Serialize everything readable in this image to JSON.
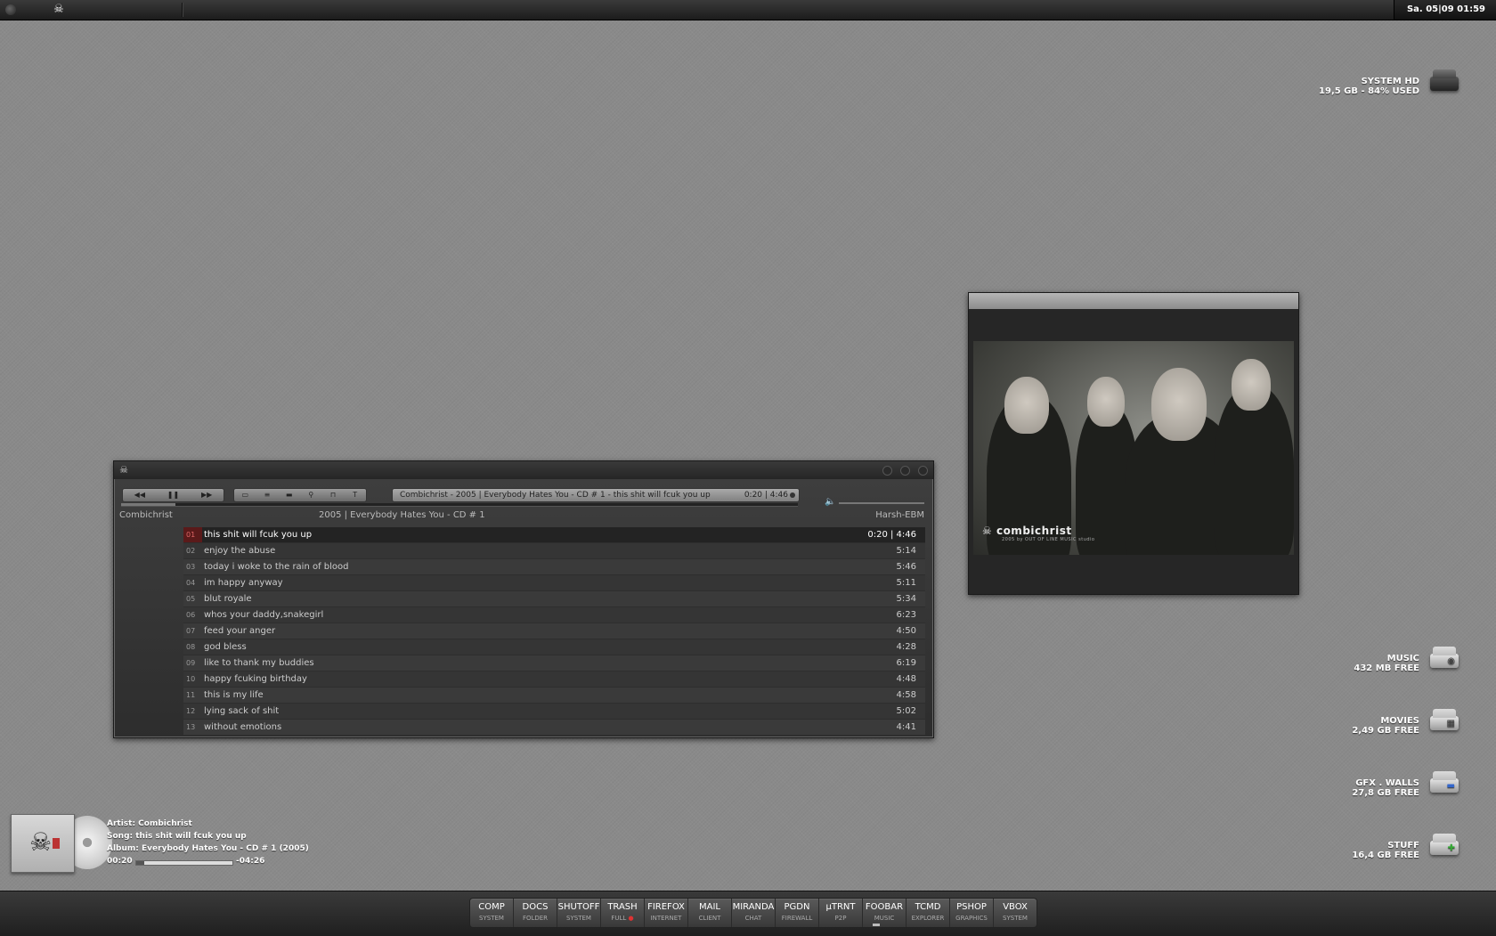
{
  "topbar": {
    "clock": "Sa. 05|09  01:59",
    "app_icon": "skull-icon"
  },
  "drives": [
    {
      "name": "SYSTEM HD",
      "info": "19,5 GB - 84% USED",
      "icon": "hard-disk-icon"
    },
    {
      "name": "MUSIC",
      "info": "432 MB FREE",
      "icon": "music-drive-icon"
    },
    {
      "name": "MOVIES",
      "info": "2,49 GB FREE",
      "icon": "movies-drive-icon"
    },
    {
      "name": "GFX . WALLS",
      "info": "27,8 GB FREE",
      "icon": "gfx-drive-icon"
    },
    {
      "name": "STUFF",
      "info": "16,4 GB FREE",
      "icon": "stuff-drive-icon"
    }
  ],
  "player": {
    "nowplaying": "Combichrist - 2005 | Everybody Hates You - CD # 1 - this shit will fcuk you up",
    "time": "0:20 | 4:46",
    "artist": "Combichrist",
    "album_line": "2005 | Everybody Hates You - CD # 1",
    "genre": "Harsh-EBM",
    "controls": {
      "prev": "◀◀",
      "pause": "❚❚",
      "next": "▶▶"
    },
    "tracks": [
      {
        "num": "01",
        "title": "this shit will fcuk you up",
        "dur": "0:20 | 4:46"
      },
      {
        "num": "02",
        "title": "enjoy the abuse",
        "dur": "5:14"
      },
      {
        "num": "03",
        "title": "today i woke to the rain of blood",
        "dur": "5:46"
      },
      {
        "num": "04",
        "title": "im happy anyway",
        "dur": "5:11"
      },
      {
        "num": "05",
        "title": "blut royale",
        "dur": "5:34"
      },
      {
        "num": "06",
        "title": "whos your daddy,snakegirl",
        "dur": "6:23"
      },
      {
        "num": "07",
        "title": "feed your anger",
        "dur": "4:50"
      },
      {
        "num": "08",
        "title": "god bless",
        "dur": "4:28"
      },
      {
        "num": "09",
        "title": "like to thank my buddies",
        "dur": "6:19"
      },
      {
        "num": "10",
        "title": "happy fcuking birthday",
        "dur": "4:48"
      },
      {
        "num": "11",
        "title": "this is my life",
        "dur": "4:58"
      },
      {
        "num": "12",
        "title": "lying sack of shit",
        "dur": "5:02"
      },
      {
        "num": "13",
        "title": "without emotions",
        "dur": "4:41"
      }
    ]
  },
  "artwork": {
    "logo": "combichrist",
    "logo_sub": "2005 by OUT OF LINE MUSIC studio"
  },
  "widget": {
    "artist": "Artist: Combichrist",
    "song": "Song: this shit will fcuk you up",
    "album": "Album: Everybody Hates You - CD # 1 (2005)",
    "elapsed": "00:20",
    "remaining": "-04:26"
  },
  "dock": [
    {
      "a": "COMP",
      "b": "SYSTEM"
    },
    {
      "a": "DOCS",
      "b": "FOLDER"
    },
    {
      "a": "SHUTOFF",
      "b": "SYSTEM"
    },
    {
      "a": "TRASH",
      "b": "FULL"
    },
    {
      "a": "FIREFOX",
      "b": "INTERNET"
    },
    {
      "a": "MAIL",
      "b": "CLIENT"
    },
    {
      "a": "MIRANDA",
      "b": "CHAT"
    },
    {
      "a": "PGDN",
      "b": "FIREWALL"
    },
    {
      "a": "µTRNT",
      "b": "P2P"
    },
    {
      "a": "FOOBAR",
      "b": "MUSIC"
    },
    {
      "a": "TCMD",
      "b": "EXPLORER"
    },
    {
      "a": "PSHOP",
      "b": "GRAPHICS"
    },
    {
      "a": "VBOX",
      "b": "SYSTEM"
    }
  ]
}
